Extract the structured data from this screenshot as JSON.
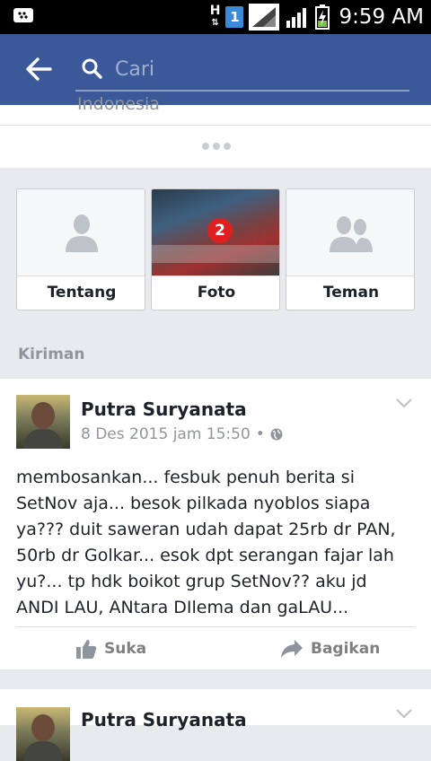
{
  "status_bar": {
    "network": "H",
    "sim": "1",
    "time": "9:59 AM"
  },
  "search": {
    "placeholder": "Cari"
  },
  "top_card": {
    "cutoff_text": "Indonesia"
  },
  "tiles": [
    {
      "label": "Tentang",
      "icon": "person-icon"
    },
    {
      "label": "Foto",
      "icon": "photo-thumbnail"
    },
    {
      "label": "Teman",
      "icon": "friends-icon"
    }
  ],
  "section_title": "Kiriman",
  "post": {
    "author": "Putra Suryanata",
    "date": "8 Des 2015 jam 15:50",
    "separator": "•",
    "text": "membosankan... fesbuk penuh berita si SetNov aja... besok pilkada nyoblos siapa ya??? duit saweran udah dapat 25rb dr PAN, 50rb dr Golkar... esok dpt serangan fajar lah yu?... tp hdk boikot grup SetNov?? aku jd ANDI LAU, ANtara DIlema dan gaLAU...",
    "like_label": "Suka",
    "share_label": "Bagikan"
  },
  "colors": {
    "brand": "#3b5998",
    "background": "#e9eaed"
  }
}
